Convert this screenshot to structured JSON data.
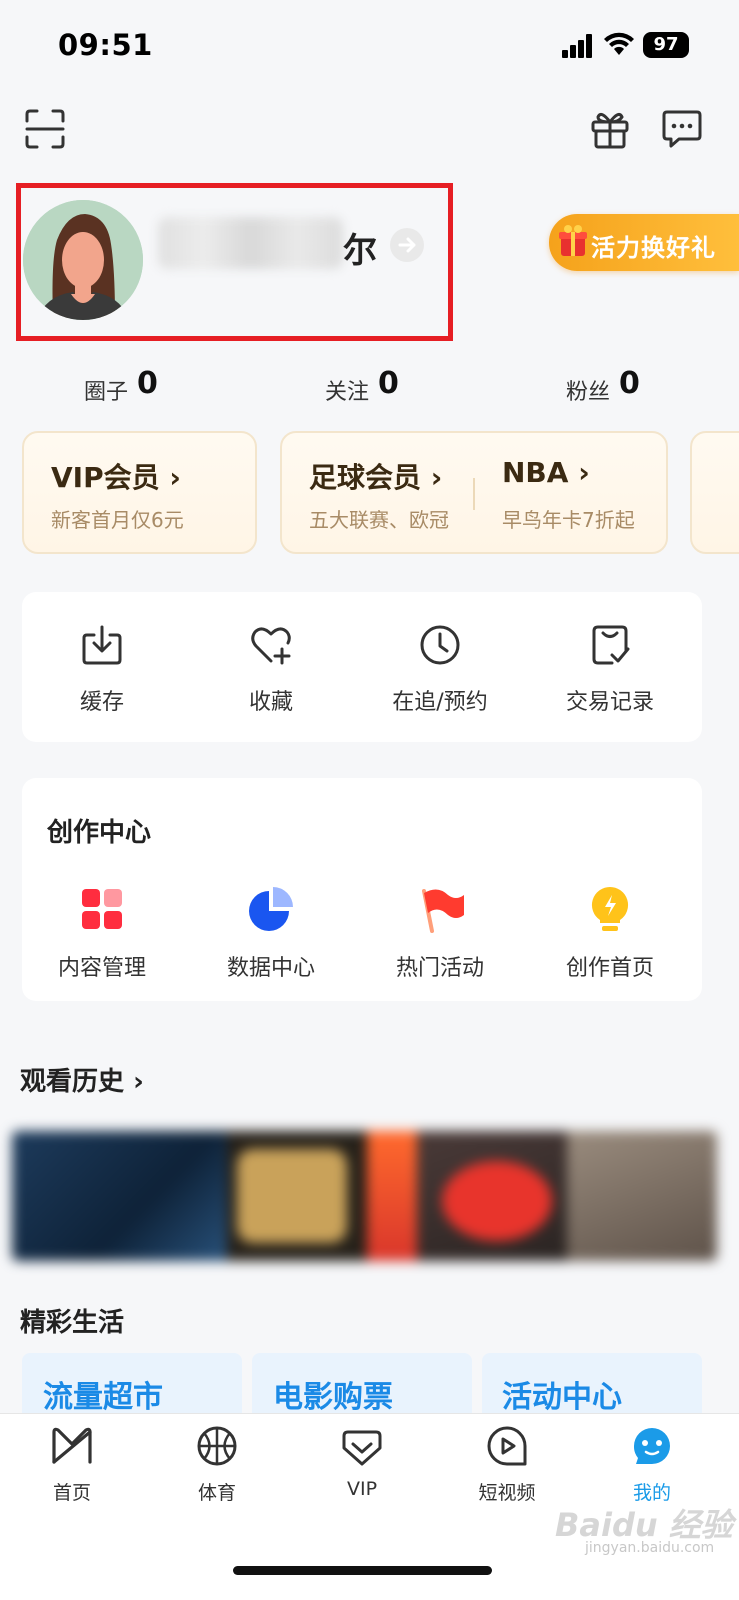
{
  "status": {
    "time": "09:51",
    "battery": "97"
  },
  "profile": {
    "name_suffix": "尔",
    "promo": "活力换好礼"
  },
  "stats": [
    {
      "label": "圈子",
      "value": "0"
    },
    {
      "label": "关注",
      "value": "0"
    },
    {
      "label": "粉丝",
      "value": "0"
    }
  ],
  "membership": [
    {
      "title": "VIP会员",
      "subtitle": "新客首月仅6元"
    },
    {
      "title": "足球会员",
      "subtitle": "五大联赛、欧冠"
    },
    {
      "title": "NBA",
      "subtitle": "早鸟年卡7折起"
    }
  ],
  "quick_actions": [
    "缓存",
    "收藏",
    "在追/预约",
    "交易记录"
  ],
  "creation": {
    "title": "创作中心",
    "items": [
      "内容管理",
      "数据中心",
      "热门活动",
      "创作首页"
    ]
  },
  "history": {
    "title": "观看历史"
  },
  "life": {
    "title": "精彩生活",
    "items": [
      "流量超市",
      "电影购票",
      "活动中心"
    ]
  },
  "tabbar": {
    "items": [
      "首页",
      "体育",
      "VIP",
      "短视频",
      "我的"
    ],
    "active_color": "#1b9be8"
  },
  "watermark": {
    "main": "Baidu 经验",
    "sub": "jingyan.baidu.com"
  }
}
